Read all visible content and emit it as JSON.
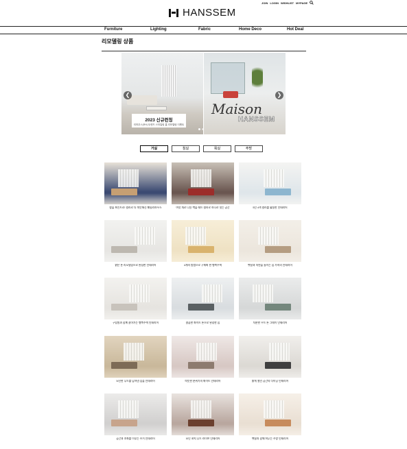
{
  "header": {
    "links": [
      "JOIN",
      "LOGIN",
      "WISHLIST",
      "MYPAGE"
    ],
    "logo_text": "HANSSEM"
  },
  "nav": [
    "Furniture",
    "Lighting",
    "Fabric",
    "Home Deco",
    "Hot Deal"
  ],
  "page_title": "리모델링 상품",
  "hero": {
    "caption_title": "2023 신규런칭",
    "caption_sub": "리하우스(RH) 트렌드 스타일링 홈 리모델링 이벤트",
    "overlay_script": "Maison",
    "overlay_brand": "HANSSEM",
    "overlay_small": "신규 런칭"
  },
  "tabs": [
    "거실",
    "침실",
    "욕실",
    "주방"
  ],
  "cards": [
    {
      "caption": "창을 포인트로! 컬러로 더 따뜻해진 패밀리하우스",
      "c1": "#3b4a72",
      "c2": "#e8e2d8",
      "c3": "#c69f73"
    },
    {
      "caption": "여섯 개로 나뉜 벽을 레드 컬러로 하나로 잇는 공간",
      "c1": "#6a5650",
      "c2": "#c8c0b6",
      "c3": "#9c2d2a"
    },
    {
      "caption": "5인 4색 컬러를 활용한 인테리어",
      "c1": "#dfe6ea",
      "c2": "#f4f4f2",
      "c3": "#8db6cf"
    },
    {
      "caption": "밝은 톤 리모델링으로 완성한 인테리어",
      "c1": "#e7e6e3",
      "c2": "#f2f2f0",
      "c3": "#bdb8b0"
    },
    {
      "caption": "4개의 방법으로 구체화 한 행복주택",
      "c1": "#efe2c4",
      "c2": "#f7eed8",
      "c3": "#d9b36d"
    },
    {
      "caption": "햇살과 자연을 들이는 집 가족의 인테리어",
      "c1": "#ece6dd",
      "c2": "#f3efe8",
      "c3": "#b59d82"
    },
    {
      "caption": "구성원과 함께 살아가는 행복주택 인테리어",
      "c1": "#e6e4e0",
      "c2": "#f3f2ef",
      "c3": "#c8c3bc"
    },
    {
      "caption": "깔끔한 화이트 톤으로 완성한 집",
      "c1": "#d9dde0",
      "c2": "#eef0f1",
      "c3": "#5a6063"
    },
    {
      "caption": "차분한 우드 톤 그레이 인테리어",
      "c1": "#d6d8d8",
      "c2": "#ebecec",
      "c3": "#74877d"
    },
    {
      "caption": "모던한 무드를 담아낸 심플 인테리어",
      "c1": "#c9b89b",
      "c2": "#e2d5bf",
      "c3": "#7d6b56"
    },
    {
      "caption": "따뜻한 분위기의 화이트 인테리어",
      "c1": "#d7c8c4",
      "c2": "#efe8e6",
      "c3": "#8d7b6f"
    },
    {
      "caption": "밝게 열린 공간의 다이닝 인테리어",
      "c1": "#dcd9d4",
      "c2": "#f1efec",
      "c3": "#3f3f3f"
    },
    {
      "caption": "공간과 조화를 이루는 주거 인테리어",
      "c1": "#d1d0cf",
      "c2": "#ecebea",
      "c3": "#c7a48c"
    },
    {
      "caption": "모던 코지 무드 라이프 인테리어",
      "c1": "#b9a79f",
      "c2": "#e9e3df",
      "c3": "#6b3f2e"
    },
    {
      "caption": "햇살과 함께 머무는 주방 인테리어",
      "c1": "#e9dfd3",
      "c2": "#f6f0e8",
      "c3": "#c78b5d"
    }
  ]
}
